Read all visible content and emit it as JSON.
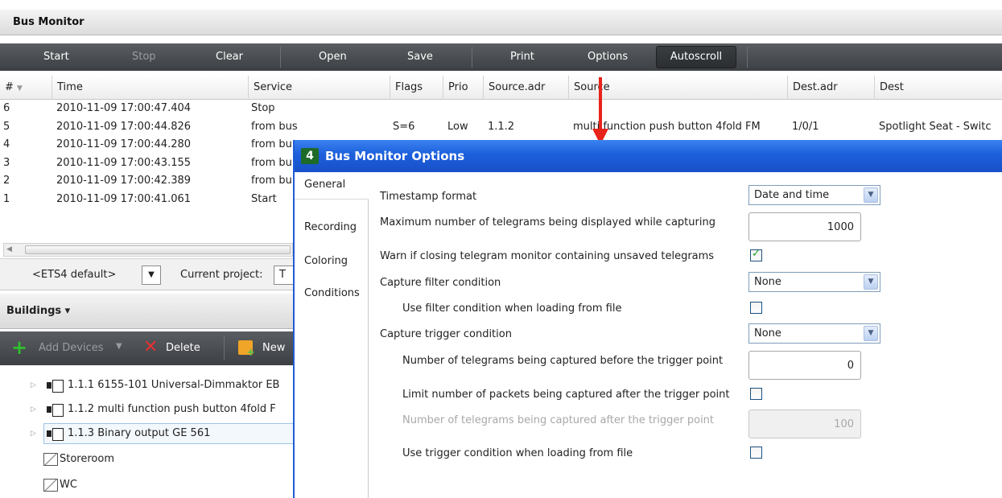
{
  "bus_monitor": {
    "title": "Bus Monitor",
    "toolbar": {
      "start": "Start",
      "stop": "Stop",
      "clear": "Clear",
      "open": "Open",
      "save": "Save",
      "print": "Print",
      "options": "Options",
      "autoscroll": "Autoscroll"
    },
    "columns": [
      "#",
      "Time",
      "Service",
      "Flags",
      "Prio",
      "Source.adr",
      "Source",
      "Dest.adr",
      "Dest"
    ],
    "rows": [
      {
        "num": "6",
        "time": "2010-11-09 17:00:47.404",
        "service": "Stop",
        "flags": "",
        "prio": "",
        "source_adr": "",
        "source": "",
        "dest_adr": "",
        "dest": ""
      },
      {
        "num": "5",
        "time": "2010-11-09 17:00:44.826",
        "service": "from bus",
        "flags": "S=6",
        "prio": "Low",
        "source_adr": "1.1.2",
        "source": "multi function push button 4fold FM",
        "dest_adr": "1/0/1",
        "dest": "Spotlight Seat - Switc"
      },
      {
        "num": "4",
        "time": "2010-11-09 17:00:44.280",
        "service": "from bu",
        "flags": "",
        "prio": "",
        "source_adr": "",
        "source": "",
        "dest_adr": "",
        "dest": ""
      },
      {
        "num": "3",
        "time": "2010-11-09 17:00:43.155",
        "service": "from bu",
        "flags": "",
        "prio": "",
        "source_adr": "",
        "source": "",
        "dest_adr": "",
        "dest": ""
      },
      {
        "num": "2",
        "time": "2010-11-09 17:00:42.389",
        "service": "from bu",
        "flags": "",
        "prio": "",
        "source_adr": "",
        "source": "",
        "dest_adr": "",
        "dest": ""
      },
      {
        "num": "1",
        "time": "2010-11-09 17:00:41.061",
        "service": "Start",
        "flags": "",
        "prio": "",
        "source_adr": "",
        "source": "",
        "dest_adr": "",
        "dest": ""
      }
    ],
    "filter": {
      "preset": "<ETS4 default>",
      "current_project_label": "Current project:",
      "current_project_value": "T"
    }
  },
  "buildings": {
    "title": "Buildings ▾",
    "toolbar": {
      "add_devices": "Add Devices",
      "delete": "Delete",
      "new": "New"
    },
    "tree": [
      {
        "label": "1.1.1  6155-101 Universal-Dimmaktor EB"
      },
      {
        "label": "1.1.2  multi function push button 4fold F"
      },
      {
        "label": "1.1.3  Binary output GE 561"
      },
      {
        "label": "Storeroom"
      },
      {
        "label": "WC"
      }
    ]
  },
  "dialog": {
    "title": "Bus Monitor Options",
    "icon_text": "4",
    "nav": [
      "General",
      "Recording",
      "Coloring",
      "Conditions"
    ],
    "options": {
      "timestamp_label": "Timestamp format",
      "timestamp_value": "Date and time",
      "max_telegrams_label": "Maximum number of telegrams being displayed while capturing",
      "max_telegrams_value": "1000",
      "warn_label": "Warn if closing telegram monitor containing unsaved telegrams",
      "warn_checked": true,
      "capture_filter_label": "Capture filter condition",
      "capture_filter_value": "None",
      "use_filter_label": "Use filter condition when loading from file",
      "use_filter_checked": false,
      "capture_trigger_label": "Capture trigger condition",
      "capture_trigger_value": "None",
      "before_trigger_label": "Number of telegrams being captured before the trigger point",
      "before_trigger_value": "0",
      "limit_packets_label": "Limit number of packets being captured after the trigger point",
      "limit_packets_checked": false,
      "after_trigger_label": "Number of telegrams being captured after the trigger point",
      "after_trigger_value": "100",
      "use_trigger_label": "Use trigger condition when loading from file",
      "use_trigger_checked": false
    }
  },
  "colors": {
    "toolbar_dark": "#3c3f43",
    "dialog_title_blue": "#1d5fdc",
    "arrow_red": "#e8231a",
    "check_green": "#21a121"
  }
}
